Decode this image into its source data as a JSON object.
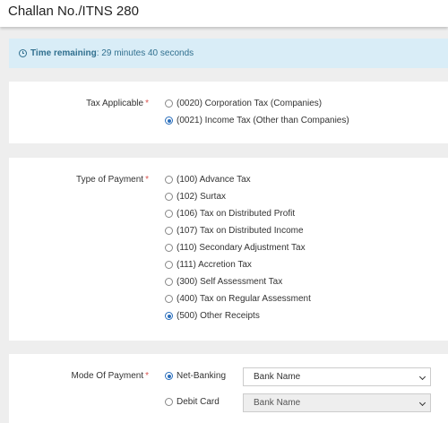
{
  "header": {
    "title": "Challan No./ITNS 280"
  },
  "timer": {
    "label": "Time remaining",
    "separator": ":",
    "value": "29 minutes 40 seconds"
  },
  "tax_applicable": {
    "label": "Tax Applicable",
    "required_mark": "*",
    "options": [
      {
        "label": "(0020) Corporation Tax (Companies)",
        "selected": false
      },
      {
        "label": "(0021) Income Tax (Other than Companies)",
        "selected": true
      }
    ]
  },
  "type_of_payment": {
    "label": "Type of Payment",
    "required_mark": "*",
    "options": [
      {
        "label": "(100) Advance Tax",
        "selected": false
      },
      {
        "label": "(102) Surtax",
        "selected": false
      },
      {
        "label": "(106) Tax on Distributed Profit",
        "selected": false
      },
      {
        "label": "(107) Tax on Distributed Income",
        "selected": false
      },
      {
        "label": "(110) Secondary Adjustment Tax",
        "selected": false
      },
      {
        "label": "(111) Accretion Tax",
        "selected": false
      },
      {
        "label": "(300) Self Assessment Tax",
        "selected": false
      },
      {
        "label": "(400) Tax on Regular Assessment",
        "selected": false
      },
      {
        "label": "(500) Other Receipts",
        "selected": true
      }
    ]
  },
  "mode_of_payment": {
    "label": "Mode Of Payment",
    "required_mark": "*",
    "options": [
      {
        "label": "Net-Banking",
        "selected": true,
        "select_value": "Bank Name",
        "select_enabled": true
      },
      {
        "label": "Debit Card",
        "selected": false,
        "select_value": "Bank Name",
        "select_enabled": false
      }
    ]
  },
  "colors": {
    "accent": "#2a6ebb",
    "required": "#d9534f",
    "timer_bg": "#d9edf7",
    "timer_text": "#31708f",
    "page_bg": "#eeeeee"
  }
}
